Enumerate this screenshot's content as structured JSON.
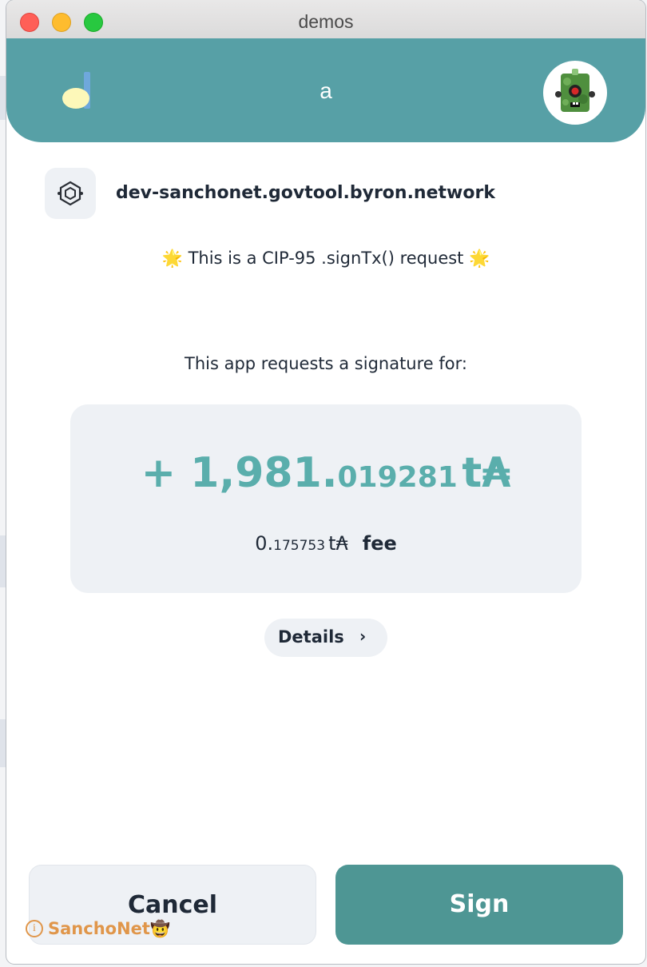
{
  "window": {
    "title": "demos"
  },
  "header": {
    "account_name": "a"
  },
  "origin": {
    "domain": "dev-sanchonet.govtool.byron.network"
  },
  "request": {
    "cip_star_left": "🌟",
    "cip_text": "This is a CIP-95 .signTx() request",
    "cip_star_right": "🌟",
    "prompt": "This app requests a signature for:"
  },
  "amount": {
    "sign": "+ ",
    "integer": "1,981.",
    "decimal": "019281",
    "unit": "t₳"
  },
  "fee": {
    "integer": "0.",
    "decimal": "175753",
    "unit": "t₳",
    "label": "fee"
  },
  "details": {
    "label": "Details",
    "chevron": "›"
  },
  "buttons": {
    "cancel": "Cancel",
    "sign": "Sign"
  },
  "network": {
    "info_glyph": "i",
    "name": "SanchoNet",
    "emoji": "🤠"
  },
  "colors": {
    "header": "#57a0a6",
    "amount": "#5aaeac",
    "sign_button": "#4e9694",
    "network_badge": "#e0964a"
  },
  "icons": {
    "logo": "app-logo-icon",
    "avatar": "robot-avatar-icon",
    "origin": "dapp-hexagon-icon"
  }
}
